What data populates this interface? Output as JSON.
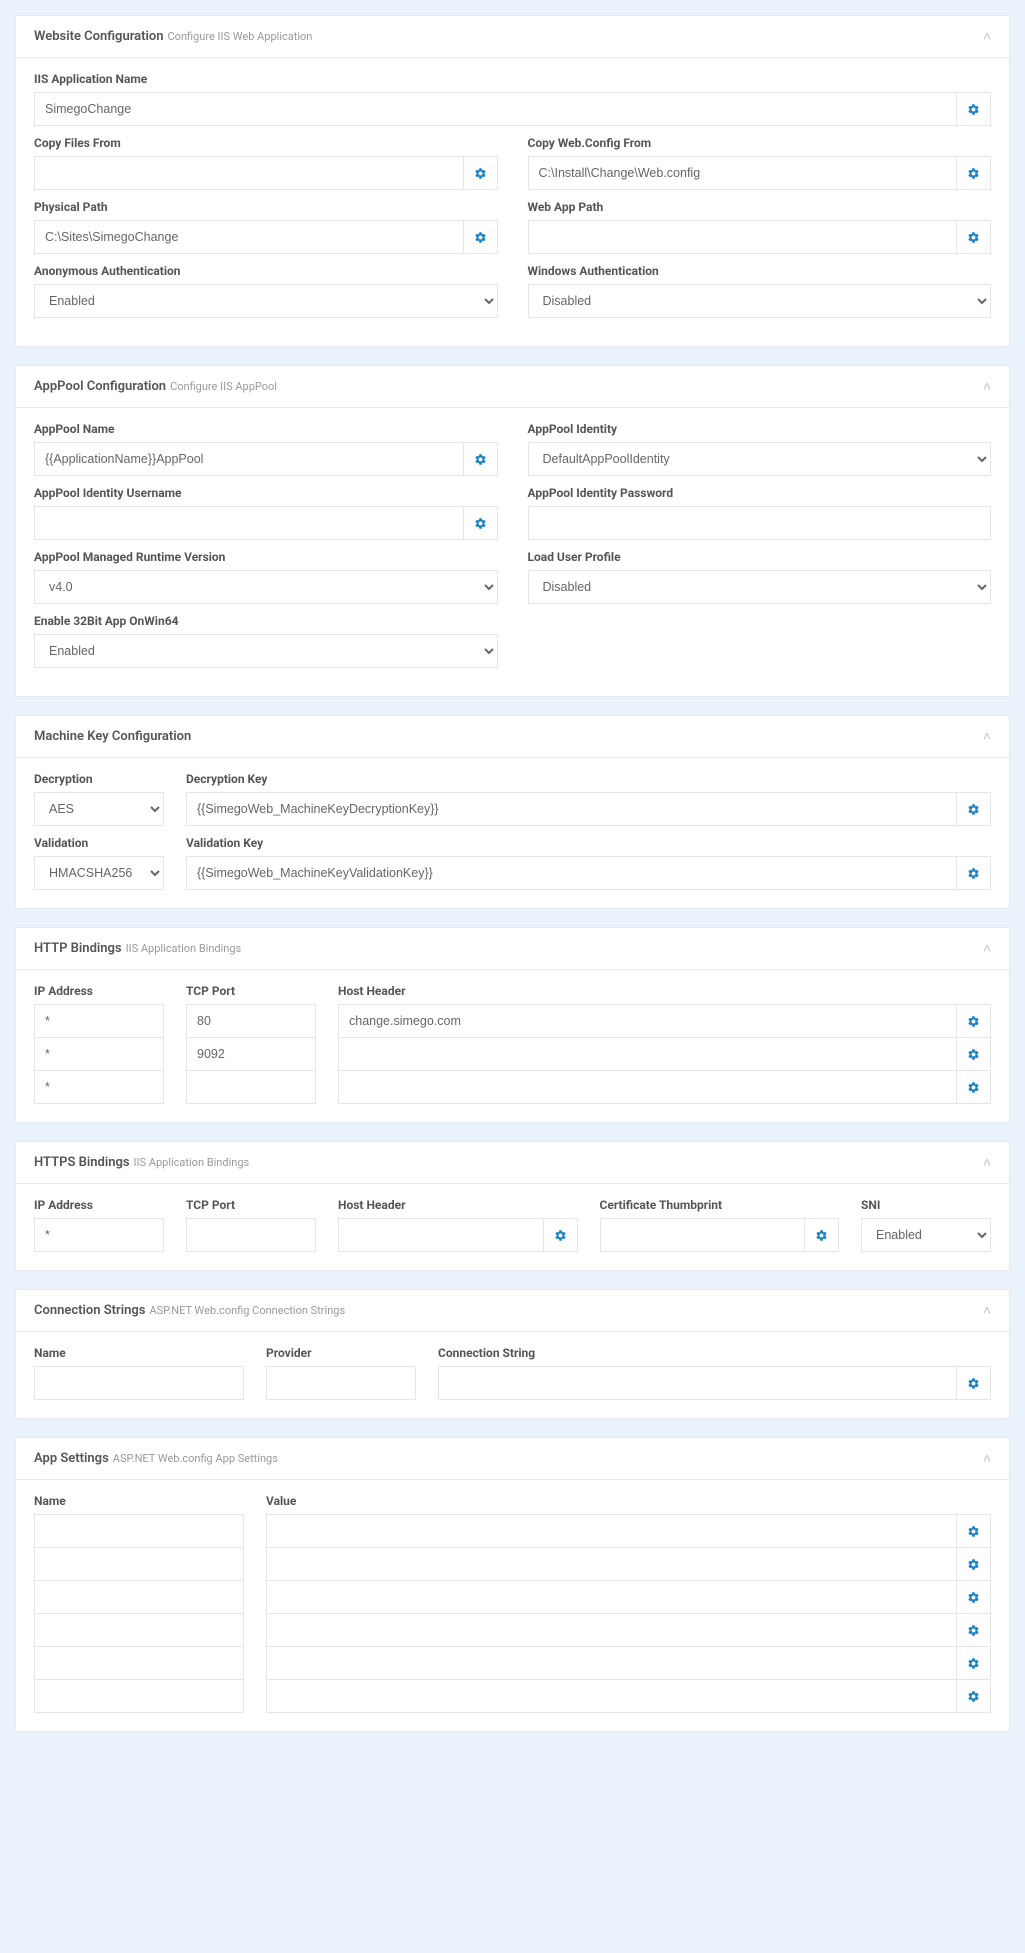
{
  "sections": {
    "website": {
      "title": "Website Configuration",
      "subtitle": "Configure IIS Web Application",
      "fields": {
        "iisAppName": {
          "label": "IIS Application Name",
          "value": "SimegoChange"
        },
        "copyFilesFrom": {
          "label": "Copy Files From",
          "value": ""
        },
        "copyWebConfigFrom": {
          "label": "Copy Web.Config From",
          "value": "C:\\Install\\Change\\Web.config"
        },
        "physicalPath": {
          "label": "Physical Path",
          "value": "C:\\Sites\\SimegoChange"
        },
        "webAppPath": {
          "label": "Web App Path",
          "value": ""
        },
        "anonAuth": {
          "label": "Anonymous Authentication",
          "value": "Enabled"
        },
        "winAuth": {
          "label": "Windows Authentication",
          "value": "Disabled"
        }
      }
    },
    "apppool": {
      "title": "AppPool Configuration",
      "subtitle": "Configure IIS AppPool",
      "fields": {
        "name": {
          "label": "AppPool Name",
          "value": "{{ApplicationName}}AppPool"
        },
        "identity": {
          "label": "AppPool Identity",
          "value": "DefaultAppPoolIdentity"
        },
        "identityUser": {
          "label": "AppPool Identity Username",
          "value": ""
        },
        "identityPass": {
          "label": "AppPool Identity Password",
          "value": ""
        },
        "runtime": {
          "label": "AppPool Managed Runtime Version",
          "value": "v4.0"
        },
        "loadUserProfile": {
          "label": "Load User Profile",
          "value": "Disabled"
        },
        "enable32": {
          "label": "Enable 32Bit App OnWin64",
          "value": "Enabled"
        }
      }
    },
    "machineKey": {
      "title": "Machine Key Configuration",
      "fields": {
        "decryption": {
          "label": "Decryption",
          "value": "AES"
        },
        "decryptionKey": {
          "label": "Decryption Key",
          "value": "{{SimegoWeb_MachineKeyDecryptionKey}}"
        },
        "validation": {
          "label": "Validation",
          "value": "HMACSHA256"
        },
        "validationKey": {
          "label": "Validation Key",
          "value": "{{SimegoWeb_MachineKeyValidationKey}}"
        }
      }
    },
    "httpBindings": {
      "title": "HTTP Bindings",
      "subtitle": "IIS Application Bindings",
      "headers": {
        "ip": "IP Address",
        "port": "TCP Port",
        "host": "Host Header"
      },
      "rows": [
        {
          "ip": "*",
          "port": "80",
          "host": "change.simego.com"
        },
        {
          "ip": "*",
          "port": "9092",
          "host": ""
        },
        {
          "ip": "*",
          "port": "",
          "host": ""
        }
      ]
    },
    "httpsBindings": {
      "title": "HTTPS Bindings",
      "subtitle": "IIS Application Bindings",
      "headers": {
        "ip": "IP Address",
        "port": "TCP Port",
        "host": "Host Header",
        "cert": "Certificate Thumbprint",
        "sni": "SNI"
      },
      "rows": [
        {
          "ip": "*",
          "port": "",
          "host": "",
          "cert": "",
          "sni": "Enabled"
        }
      ]
    },
    "connStrings": {
      "title": "Connection Strings",
      "subtitle": "ASP.NET Web.config Connection Strings",
      "headers": {
        "name": "Name",
        "provider": "Provider",
        "conn": "Connection String"
      },
      "rows": [
        {
          "name": "",
          "provider": "",
          "conn": ""
        }
      ]
    },
    "appSettings": {
      "title": "App Settings",
      "subtitle": "ASP.NET Web.config App Settings",
      "headers": {
        "name": "Name",
        "value": "Value"
      },
      "rows": [
        {
          "name": "",
          "value": ""
        },
        {
          "name": "",
          "value": ""
        },
        {
          "name": "",
          "value": ""
        },
        {
          "name": "",
          "value": ""
        },
        {
          "name": "",
          "value": ""
        },
        {
          "name": "",
          "value": ""
        }
      ]
    }
  },
  "options": {
    "enabledDisabled": [
      "Enabled",
      "Disabled"
    ]
  }
}
